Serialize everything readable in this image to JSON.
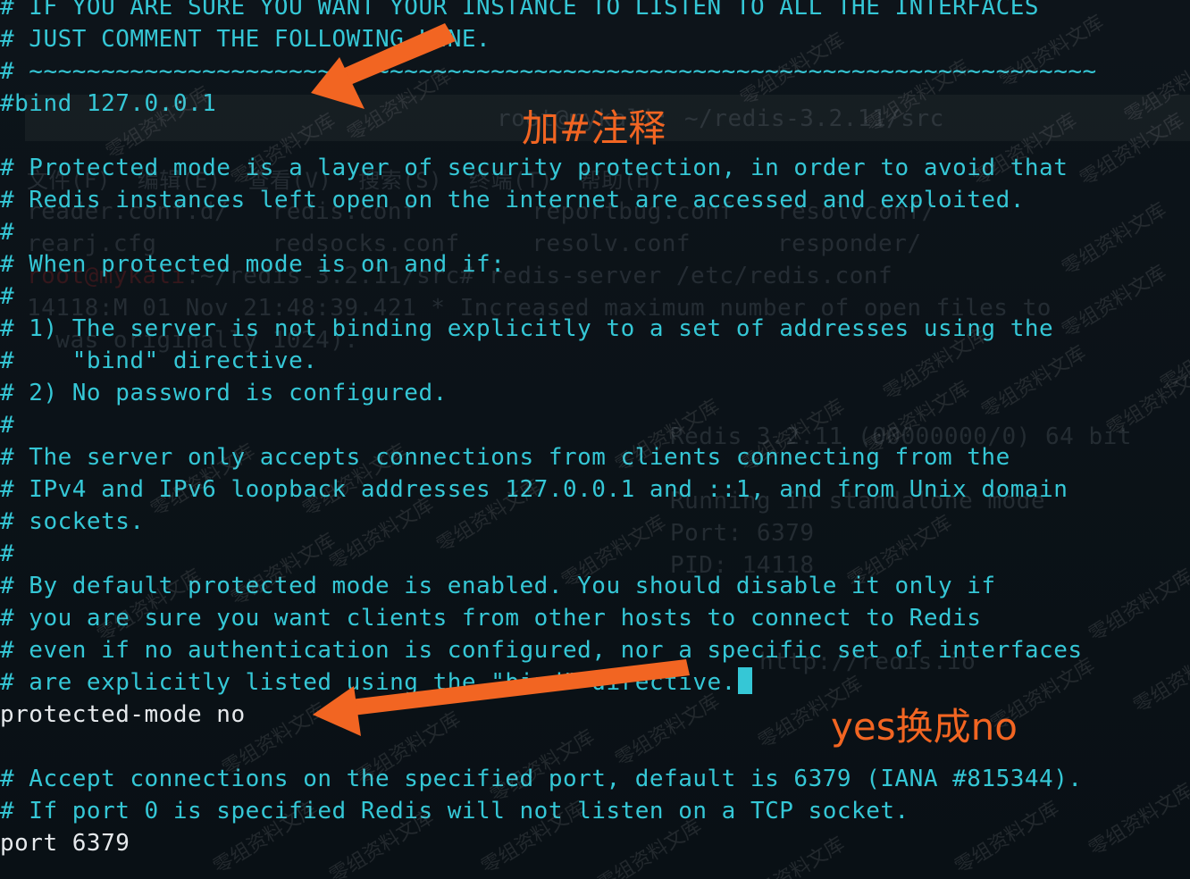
{
  "terminal": {
    "lines": [
      "# IF YOU ARE SURE YOU WANT YOUR INSTANCE TO LISTEN TO ALL THE INTERFACES",
      "# JUST COMMENT THE FOLLOWING LINE.",
      "# ~~~~~~~~~~~~~~~~~~~~~~~~~~~~~~~~~~~~~~~~~~~~~~~~~~~~~~~~~~~~~~~~~~~~~~~~~~",
      "#bind 127.0.0.1",
      "",
      "# Protected mode is a layer of security protection, in order to avoid that",
      "# Redis instances left open on the internet are accessed and exploited.",
      "#",
      "# When protected mode is on and if:",
      "#",
      "# 1) The server is not binding explicitly to a set of addresses using the",
      "#    \"bind\" directive.",
      "# 2) No password is configured.",
      "#",
      "# The server only accepts connections from clients connecting from the",
      "# IPv4 and IPv6 loopback addresses 127.0.0.1 and ::1, and from Unix domain",
      "# sockets.",
      "#",
      "# By default protected mode is enabled. You should disable it only if",
      "# you are sure you want clients from other hosts to connect to Redis",
      "# even if no authentication is configured, nor a specific set of interfaces",
      "# are explicitly listed using the \"bind\" directive.",
      "protected-mode no",
      "",
      "# Accept connections on the specified port, default is 6379 (IANA #815344).",
      "# If port 0 is specified Redis will not listen on a TCP socket.",
      "port 6379"
    ]
  },
  "background_ghost": {
    "title_path": "root@mykali: ~/redis-3.2.11/src",
    "menu": "文件(F)  编辑(E)  查看(V)  搜索(S)  终端(T)  帮助(H)",
    "ls_row1": "reader.conf.d/   redis.conf        reportbug.conf   resolvconf/",
    "ls_row2": "rearj.cfg        redsocks.conf     resolv.conf      responder/",
    "prompt_user": "root@mykali",
    "prompt_rest": ":~/redis-3.2.11/src# redis-server /etc/redis.conf",
    "log1": "14118:M 01 Nov 21:48:39.421 * Increased maximum number of open files to",
    "log2": "  was originally 1024).",
    "banner1": "Redis 3.2.11 (00000000/0) 64 bit",
    "banner2": "Running in standalone mode",
    "banner3": "Port: 6379",
    "banner4": "PID: 14118",
    "banner5": "http://redis.io"
  },
  "annotations": {
    "comment_note": "加#注释",
    "replace_note": "yes换成no"
  },
  "watermark": "零组资料文库",
  "colors": {
    "comment_text": "#35c7d6",
    "config_text": "#e6e9ec",
    "annotation": "#f26522"
  }
}
